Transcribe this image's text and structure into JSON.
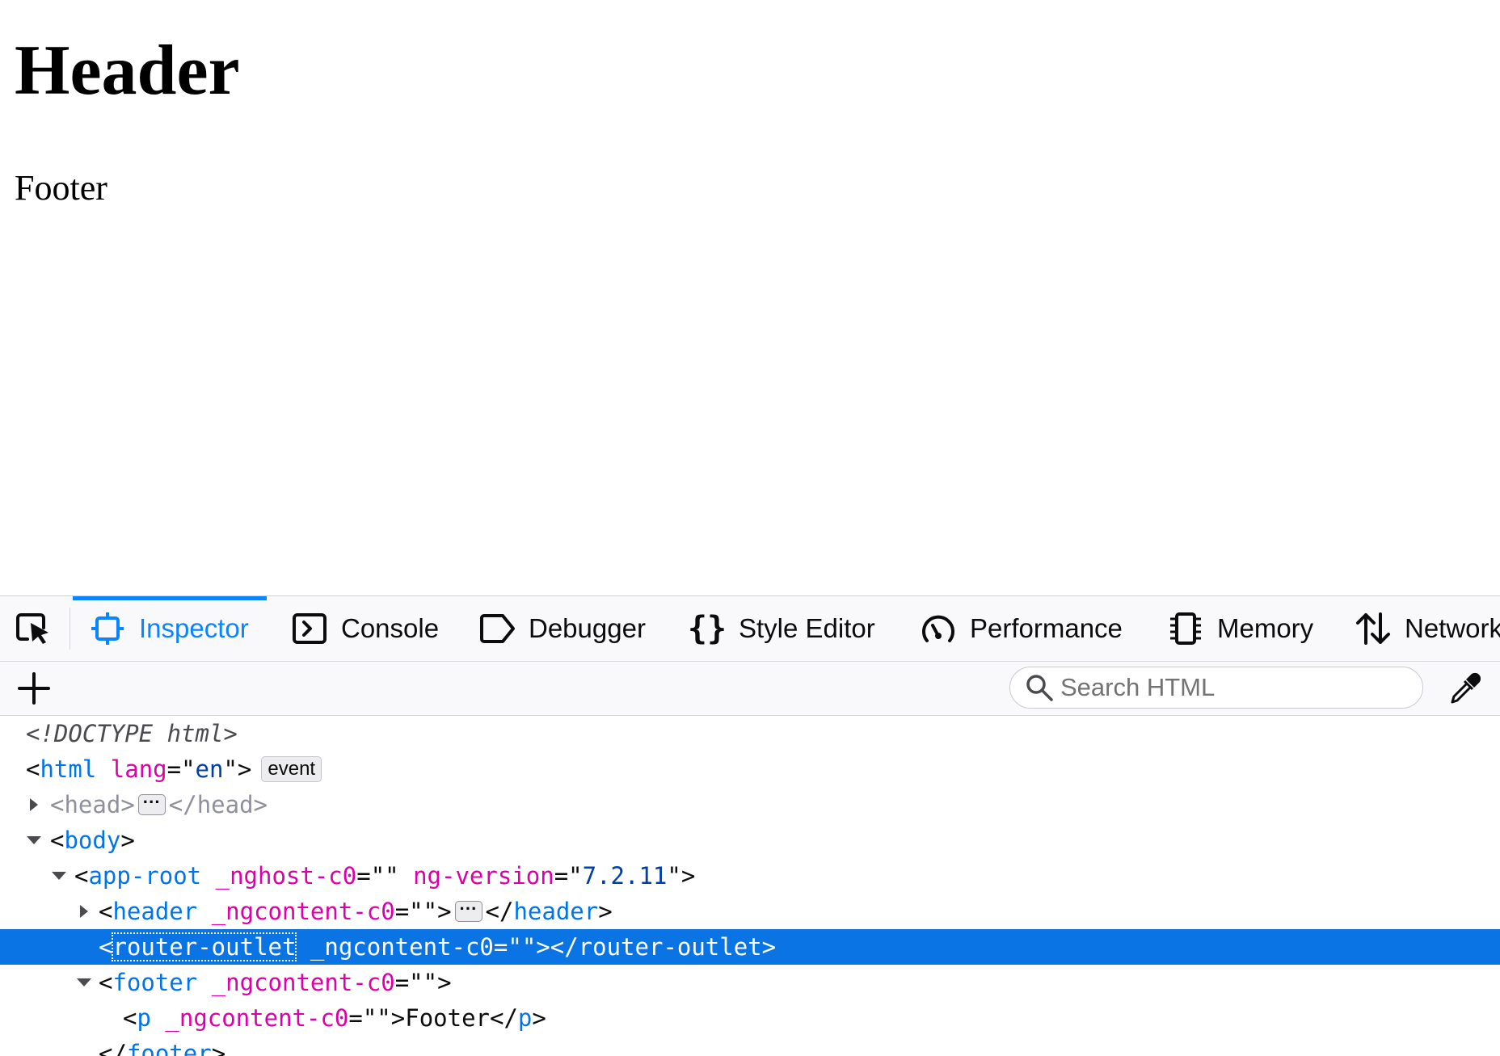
{
  "page": {
    "heading": "Header",
    "footer_text": "Footer"
  },
  "devtools": {
    "tabs": [
      {
        "label": "Inspector",
        "icon": "inspector-icon",
        "selected": true
      },
      {
        "label": "Console",
        "icon": "console-icon"
      },
      {
        "label": "Debugger",
        "icon": "debugger-icon"
      },
      {
        "label": "Style Editor",
        "icon": "braces-icon"
      },
      {
        "label": "Performance",
        "icon": "gauge-icon"
      },
      {
        "label": "Memory",
        "icon": "chip-icon"
      },
      {
        "label": "Network",
        "icon": "updown-arrows-icon"
      }
    ],
    "search": {
      "placeholder": "Search HTML",
      "value": ""
    },
    "markup": {
      "doctype": "<!DOCTYPE html>",
      "html_tag": "html",
      "html_attr": "lang",
      "html_val": "en",
      "event_badge": "event",
      "head_tag": "head",
      "body_tag": "body",
      "app_root_tag": "app-root",
      "nghost_attr": "_nghost-c0",
      "ngversion_attr": "ng-version",
      "ngversion_val": "7.2.11",
      "header_tag": "header",
      "ngcontent_attr": "_ngcontent-c0",
      "router_tag": "router-outlet",
      "footer_tag": "footer",
      "p_tag": "p",
      "p_text": "Footer"
    }
  },
  "colors": {
    "accent": "#0a84ff",
    "selected_row": "#0a74e4",
    "tag": "#0074e8",
    "attr": "#dd00a9",
    "value": "#003eaa"
  }
}
